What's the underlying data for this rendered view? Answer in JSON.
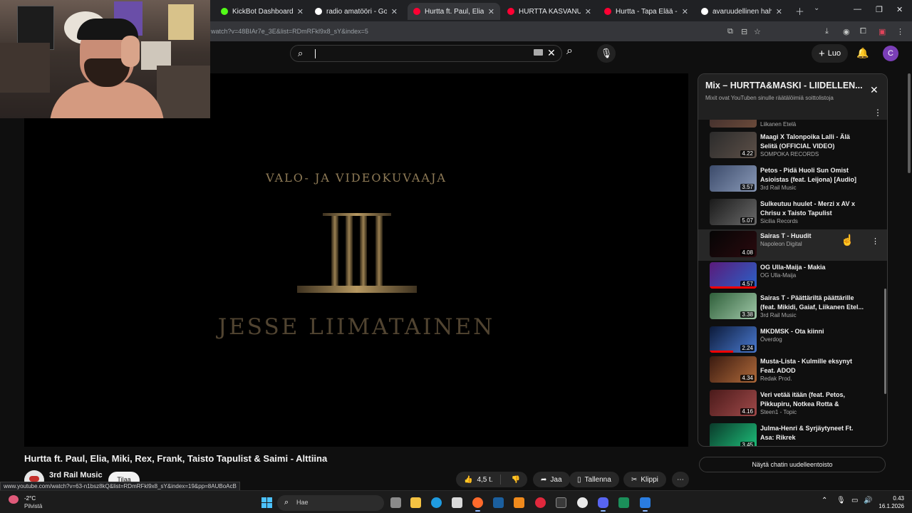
{
  "browser": {
    "tabs": [
      {
        "label": "KickBot Dashboard",
        "favicon_color": "#53fc18",
        "active": false
      },
      {
        "label": "radio amatööri - Google-h",
        "favicon_color": "#ffffff",
        "active": false
      },
      {
        "label": "Hurtta ft. Paul, Elia, Miki, Re",
        "favicon_color": "#ff0033",
        "active": true
      },
      {
        "label": "HURTTA KASVANU VÄHÄN",
        "favicon_color": "#ff0033",
        "active": false
      },
      {
        "label": "Hurtta - Tapa Elää - YouTub",
        "favicon_color": "#ff0033",
        "active": false
      },
      {
        "label": "avaruudellinen hahmotus",
        "favicon_color": "#ffffff",
        "active": false
      }
    ],
    "url": "watch?v=48BIAr7e_3E&list=RDmRFkl9x8_sY&index=5"
  },
  "header": {
    "search_value": "",
    "create_label": "Luo",
    "avatar_letter": "C",
    "accent_color": "#ff0033"
  },
  "player": {
    "subtitle": "VALO- JA VIDEOKUVAAJA",
    "name": "JESSE LIIMATAINEN"
  },
  "video": {
    "title": "Hurtta ft. Paul, Elia, Miki, Rex, Frank, Taisto Tapulist & Saimi - Alttiina",
    "channel": "3rd Rail Music",
    "subscribe_label": "Tilaa",
    "likes": "4,5 t.",
    "share_label": "Jaa",
    "save_label": "Tallenna",
    "clip_label": "Klippi"
  },
  "status_url": "www.youtube.com/watch?v=63-n1bsz8kQ&list=RDmRFkl9x8_sY&index=19&pp=8AUBoAcB",
  "playlist": {
    "title": "Mix – HURTTA&MASKI - LIIDELLEN...",
    "subtitle": "Mixit ovat YouTuben sinulle räätälöimiä soittolistoja",
    "show_chat_label": "Näytä chatin uudelleentoisto",
    "partial_top_channel": "Liikanen Etelä",
    "items": [
      {
        "title": "Maagi X Talonpoika Lalli - Älä Selitä (OFFICIAL VIDEO)",
        "channel": "SOMPOKA RECORDS",
        "duration": "4.22",
        "progress": 0
      },
      {
        "title": "Petos - Pidä Huoli Sun Omist Asioistas (feat. Leijona) [Audio]",
        "channel": "3rd Rail Music",
        "duration": "3.57",
        "progress": 0
      },
      {
        "title": "Sulkeutuu huulet - Merzi x AV x Chrisu x Taisto Tapulist",
        "channel": "Sicilia Records",
        "duration": "5.07",
        "progress": 0
      },
      {
        "title": "Sairas T - Huudit",
        "channel": "Napoleon Digital",
        "duration": "4.08",
        "progress": 0
      },
      {
        "title": "OG Ulla-Maija - Makia",
        "channel": "OG Ulla-Maija",
        "duration": "4.57",
        "progress": 1
      },
      {
        "title": "Sairas T - Päättäriltä päättärille (feat. Mikidi, Gaiaf, Liikanen Etel...",
        "channel": "3rd Rail Music",
        "duration": "3.38",
        "progress": 0
      },
      {
        "title": "MKDMSK - Ota kiinni",
        "channel": "Överdog",
        "duration": "2.24",
        "progress": 0.5
      },
      {
        "title": "Musta-Lista - Kulmille eksynyt Feat. ADOD",
        "channel": "Redak Prod.",
        "duration": "4.34",
        "progress": 0
      },
      {
        "title": "Veri vetää itään (feat. Petos, Pikkupiru, Notkea Rotta & Rohto...",
        "channel": "Steen1 - Topic",
        "duration": "4.16",
        "progress": 0
      },
      {
        "title": "Julma-Henri & Syrjäytyneet Ft. Asa: Rikrek",
        "channel": "",
        "duration": "3.45",
        "progress": 0
      }
    ]
  },
  "taskbar": {
    "temperature": "-2°C",
    "weather": "Pilvistä",
    "search_label": "Hae",
    "time": "0.43",
    "date": "16.1.2026"
  }
}
